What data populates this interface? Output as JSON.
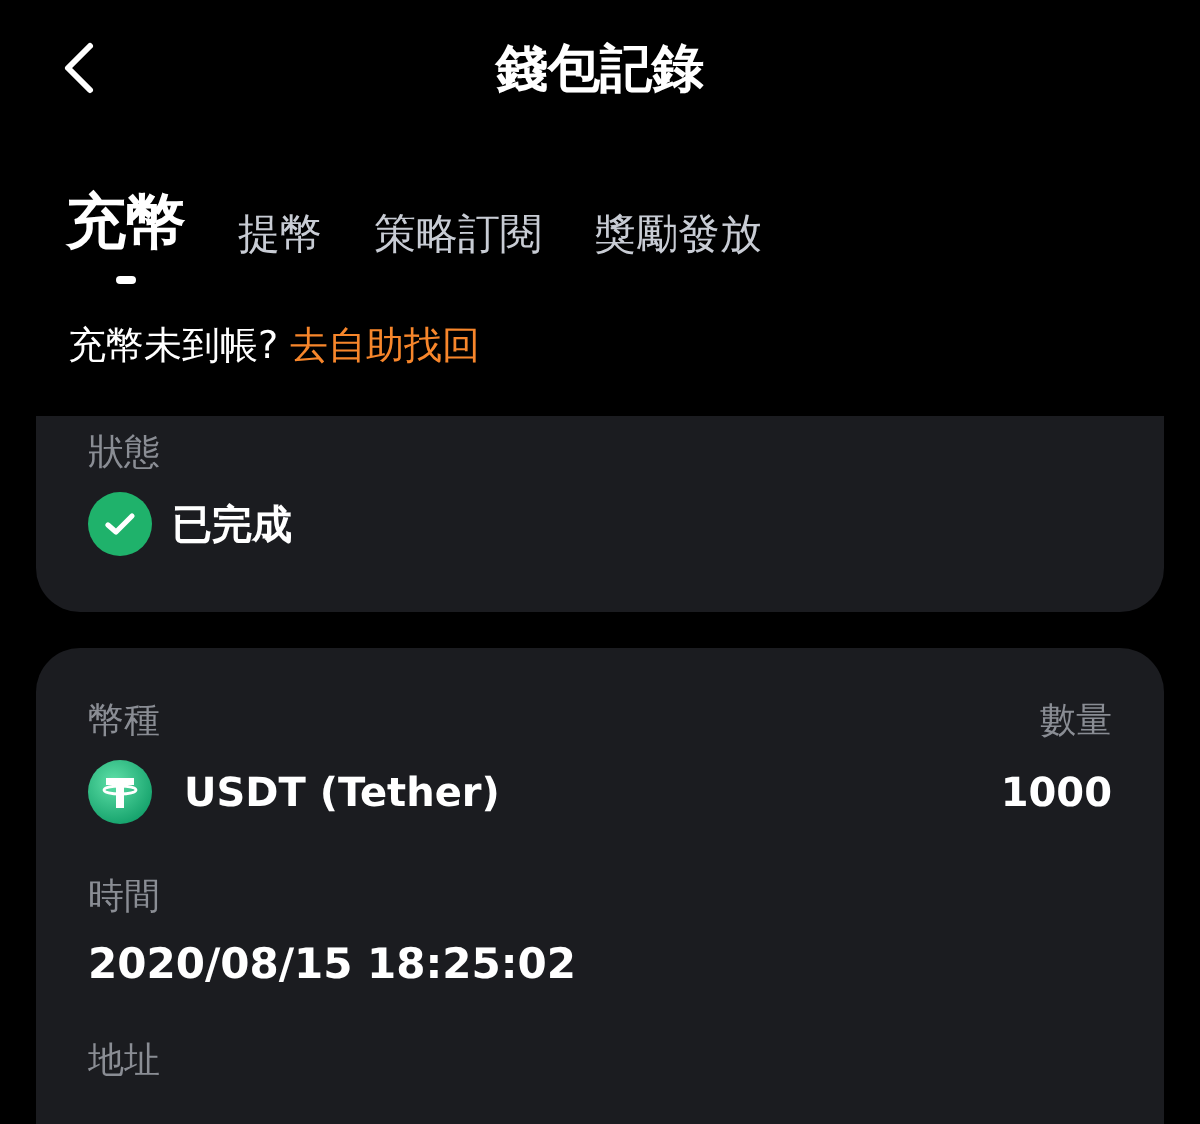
{
  "header": {
    "title": "錢包記錄"
  },
  "tabs": [
    {
      "label": "充幣",
      "selected": true
    },
    {
      "label": "提幣",
      "selected": false
    },
    {
      "label": "策略訂閱",
      "selected": false
    },
    {
      "label": "獎勵發放",
      "selected": false
    }
  ],
  "notice": {
    "text": "充幣未到帳?",
    "link": "去自助找回"
  },
  "status_card": {
    "label": "狀態",
    "value": "已完成",
    "completed": true
  },
  "detail_card": {
    "coin_label": "幣種",
    "amount_label": "數量",
    "coin": "USDT (Tether)",
    "amount": "1000",
    "time_label": "時間",
    "time": "2020/08/15 18:25:02",
    "address_label": "地址"
  }
}
